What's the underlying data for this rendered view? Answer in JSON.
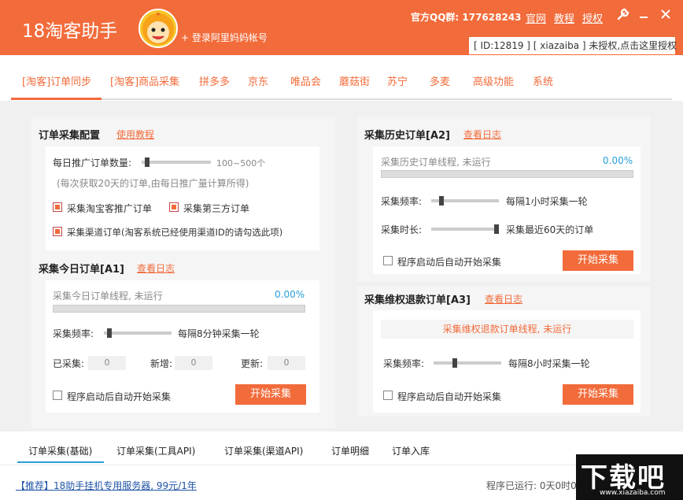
{
  "header": {
    "app_title": "18淘客助手",
    "login_label": "+ 登录阿里妈妈帐号",
    "qq_label": "官方QQ群: 177628243",
    "links": [
      "官网",
      "教程",
      "授权"
    ],
    "id_bar": "[ ID:12819 ] [ xiazaiba ] 未授权,点击这里授权"
  },
  "nav": {
    "tabs": [
      "[淘客]订单同步",
      "[淘客]商品采集",
      "拼多多",
      "京东",
      "唯品会",
      "蘑菇街",
      "苏宁",
      "多麦",
      "高级功能",
      "系统"
    ],
    "active_index": 0
  },
  "config": {
    "title": "订单采集配置",
    "help_link": "使用教程",
    "daily_label": "每日推广订单数量:",
    "daily_value": "100~500个",
    "daily_fraction": 0.05,
    "note": "(每次获取20天的订单,由每日推广量计算所得)",
    "options": [
      {
        "label": "采集淘宝客推广订单",
        "checked": true
      },
      {
        "label": "采集第三方订单",
        "checked": true
      },
      {
        "label": "采集渠道订单(淘客系统已经使用渠道ID的请勾选此项)",
        "checked": true
      }
    ]
  },
  "today": {
    "title": "采集今日订单[A1]",
    "log_link": "查看日志",
    "status": "采集今日订单线程, 未运行",
    "progress": "0.00%",
    "progress_fraction": 0,
    "freq_label": "采集频率:",
    "freq_value": "每隔8分钟采集一轮",
    "freq_fraction": 0.05,
    "stats": [
      {
        "label": "已采集:",
        "value": "0"
      },
      {
        "label": "新增:",
        "value": "0"
      },
      {
        "label": "更新:",
        "value": "0"
      }
    ],
    "autostart_label": "程序启动后自动开始采集",
    "autostart_checked": false,
    "start_label": "开始采集"
  },
  "history": {
    "title": "采集历史订单[A2]",
    "log_link": "查看日志",
    "status": "采集历史订单线程, 未运行",
    "progress": "0.00%",
    "progress_fraction": 0,
    "freq_label": "采集频率:",
    "freq_value": "每隔1小时采集一轮",
    "freq_fraction": 0.12,
    "duration_label": "采集时长:",
    "duration_value": "采集最近60天的订单",
    "duration_fraction": 1.0,
    "autostart_label": "程序启动后自动开始采集",
    "autostart_checked": false,
    "start_label": "开始采集"
  },
  "refund": {
    "title": "采集维权退款订单[A3]",
    "log_link": "查看日志",
    "status": "采集维权退款订单线程, 未运行",
    "freq_label": "采集频率:",
    "freq_value": "每隔8小时采集一轮",
    "freq_fraction": 0.3,
    "autostart_label": "程序启动后自动开始采集",
    "autostart_checked": false,
    "start_label": "开始采集"
  },
  "bottom_tabs": {
    "tabs": [
      "订单采集(基础)",
      "订单采集(工具API)",
      "订单采集(渠道API)",
      "订单明细",
      "订单入库"
    ],
    "active_index": 0
  },
  "footer": {
    "promo": "【推荐】18助手挂机专用服务器, 99元/1年",
    "runtime": "程序已运行: 0天0时0分"
  },
  "watermark": {
    "title": "下载吧",
    "url": "www.xiazaiba.com"
  },
  "icons": {
    "settings": "wrench-icon",
    "minimize": "minimize-icon",
    "close": "close-icon"
  },
  "colors": {
    "accent": "#f26b3a",
    "link_blue": "#2a9fd6"
  }
}
